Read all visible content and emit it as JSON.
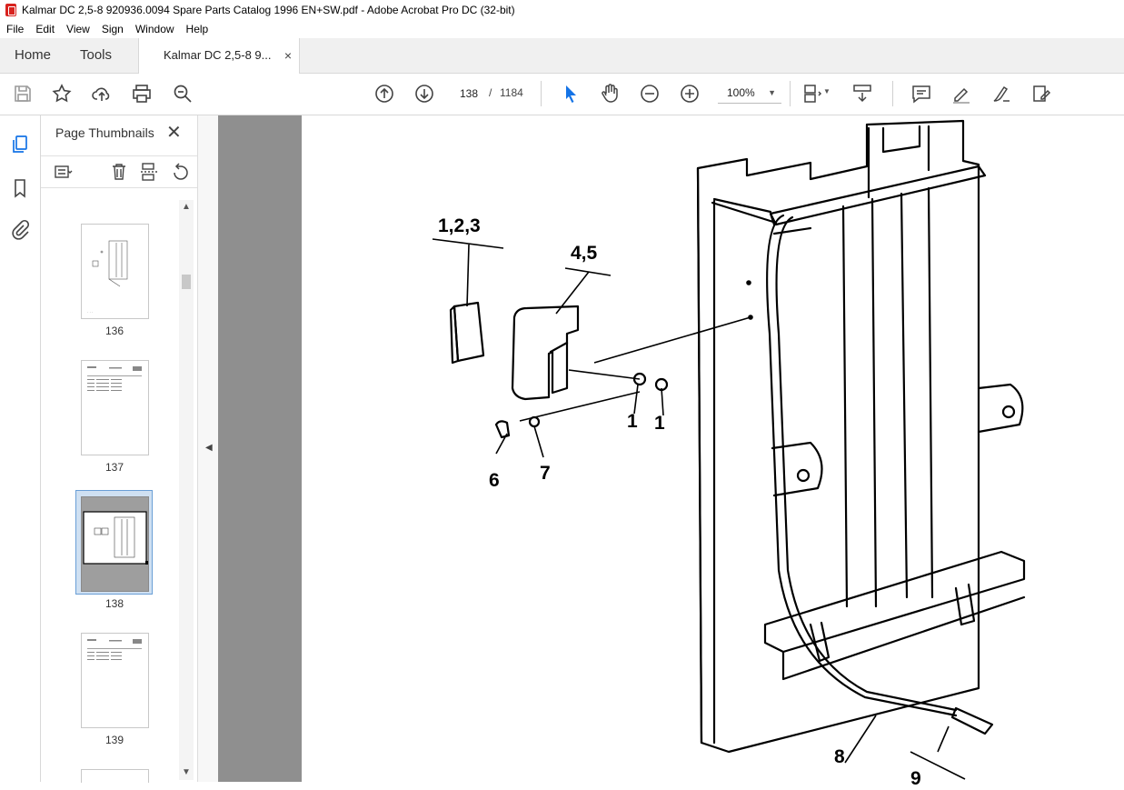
{
  "window": {
    "title": "Kalmar DC 2,5-8 920936.0094 Spare Parts Catalog 1996 EN+SW.pdf - Adobe Acrobat Pro DC (32-bit)"
  },
  "menu": [
    "File",
    "Edit",
    "View",
    "Sign",
    "Window",
    "Help"
  ],
  "tabs": {
    "home": "Home",
    "tools": "Tools",
    "document": "Kalmar DC 2,5-8 9...",
    "close_glyph": "×"
  },
  "toolbar": {
    "current_page": "138",
    "page_separator": "/",
    "total_pages": "1184",
    "zoom": "100%"
  },
  "sidebar": {
    "title": "Page Thumbnails",
    "close_glyph": "✕",
    "thumbnails": [
      {
        "label": "136",
        "selected": false
      },
      {
        "label": "137",
        "selected": false
      },
      {
        "label": "138",
        "selected": true
      },
      {
        "label": "139",
        "selected": false
      }
    ]
  },
  "diagram": {
    "callouts": [
      "1,2,3",
      "4,5",
      "1",
      "1",
      "6",
      "7",
      "8",
      "9"
    ]
  },
  "colors": {
    "accent": "#1473e6",
    "acrobat_red": "#d8231f",
    "canvas_gray": "#8f8f8f"
  }
}
